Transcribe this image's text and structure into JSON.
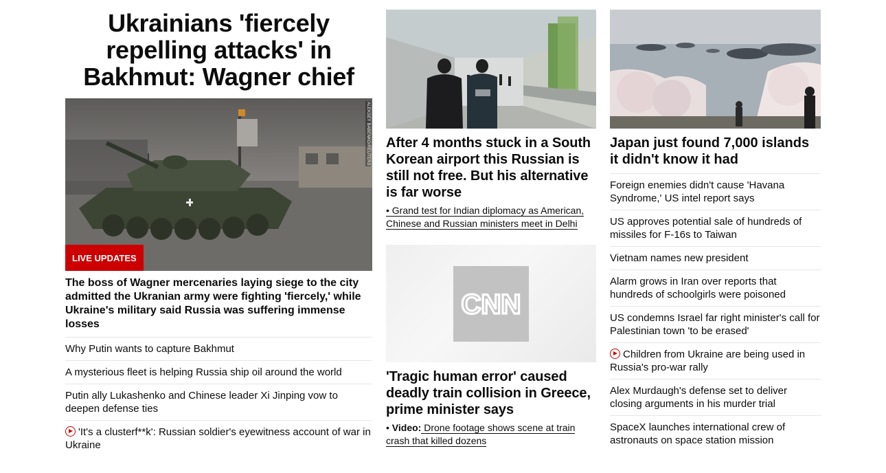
{
  "lead": {
    "headline": "Ukrainians 'fiercely repelling attacks' in Bakhmut: Wagner chief",
    "image_credit": "ALEKSEY BABENKO/REUTERS",
    "badge": "LIVE UPDATES",
    "summary": "The boss of Wagner mercenaries laying siege to the city admitted the Ukranian army were fighting 'fiercely,' while Ukraine's military said Russia was suffering immense losses",
    "links": [
      {
        "text": "Why Putin wants to capture Bakhmut",
        "video": false
      },
      {
        "text": "A mysterious fleet is helping Russia ship oil around the world",
        "video": false
      },
      {
        "text": "Putin ally Lukashenko and Chinese leader Xi Jinping vow to deepen defense ties",
        "video": false
      },
      {
        "text": "'It's a clusterf**k': Russian soldier's eyewitness account of war in Ukraine",
        "video": true
      }
    ]
  },
  "middle": {
    "story1": {
      "headline": "After 4 months stuck in a South Korean airport this Russian is still not free. But his alternative is far worse",
      "sub": "• Grand test for Indian diplomacy as American, Chinese and Russian ministers meet in Delhi"
    },
    "story2": {
      "logo": "CNN",
      "headline": "'Tragic human error' caused deadly train collision in Greece, prime minister says",
      "sub_prefix": "• ",
      "sub_bold": "Video:",
      "sub_text": " Drone footage shows scene at train crash that killed dozens"
    }
  },
  "right": {
    "headline": "Japan just found 7,000 islands it didn't know it had",
    "links": [
      {
        "text": "Foreign enemies didn't cause 'Havana Syndrome,' US intel report says",
        "video": false
      },
      {
        "text": "US approves potential sale of hundreds of missiles for F-16s to Taiwan",
        "video": false
      },
      {
        "text": "Vietnam names new president",
        "video": false
      },
      {
        "text": "Alarm grows in Iran over reports that hundreds of schoolgirls were poisoned",
        "video": false
      },
      {
        "text": "US condemns Israel far right minister's call for Palestinian town 'to be erased'",
        "video": false
      },
      {
        "text": "Children from Ukraine are being used in Russia's pro-war rally",
        "video": true
      },
      {
        "text": "Alex Murdaugh's defense set to deliver closing arguments in his murder trial",
        "video": false
      },
      {
        "text": "SpaceX launches international crew of astronauts on space station mission",
        "video": false
      }
    ]
  },
  "colors": {
    "accent": "#cc0000",
    "text": "#0c0c0c",
    "divider": "#e6e6e6"
  }
}
